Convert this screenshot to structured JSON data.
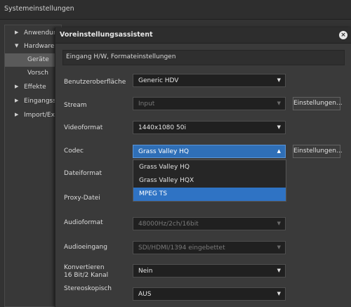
{
  "window": {
    "title": "Systemeinstellungen"
  },
  "tree": [
    {
      "label": "Anwendun",
      "expanded": false,
      "has_arrow": true
    },
    {
      "label": "Hardware",
      "expanded": true,
      "has_arrow": true
    },
    {
      "label": "Geräte",
      "selected": true,
      "has_arrow": false
    },
    {
      "label": "Vorsch",
      "has_arrow": false
    },
    {
      "label": "Effekte",
      "expanded": false,
      "has_arrow": true
    },
    {
      "label": "Eingangsst",
      "expanded": false,
      "has_arrow": true
    },
    {
      "label": "Import/Exp",
      "expanded": false,
      "has_arrow": true
    }
  ],
  "dialog": {
    "title": "Voreinstellungsassistent",
    "section": "Eingang H/W, Formateinstellungen",
    "rows": {
      "benutzeroberflaeche": {
        "label": "Benutzeroberfläche",
        "value": "Generic HDV"
      },
      "stream": {
        "label": "Stream",
        "value": "Input",
        "button": "Einstellungen..."
      },
      "videoformat": {
        "label": "Videoformat",
        "value": "1440x1080 50i"
      },
      "codec": {
        "label": "Codec",
        "value": "Grass Valley HQ",
        "button": "Einstellungen..."
      },
      "dateiformat": {
        "label": "Dateiformat"
      },
      "proxy": {
        "label": "Proxy-Datei"
      },
      "audioformat": {
        "label": "Audioformat",
        "value": "48000Hz/2ch/16bit"
      },
      "audioeingang": {
        "label": "Audioeingang",
        "value": "SDI/HDMI/1394 eingebettet"
      },
      "konvertieren": {
        "label_line1": "Konvertieren",
        "label_line2": "16 Bit/2 Kanal",
        "value": "Nein"
      },
      "stereoskopisch": {
        "label": "Stereoskopisch",
        "value": "AUS"
      }
    },
    "codec_options": [
      "Grass Valley HQ",
      "Grass Valley HQX",
      "MPEG TS"
    ],
    "codec_highlighted": "MPEG TS"
  },
  "icons": {
    "close": "close-icon",
    "chevron": "chevron-down-icon",
    "tree_arrow": "triangle-right-icon"
  }
}
